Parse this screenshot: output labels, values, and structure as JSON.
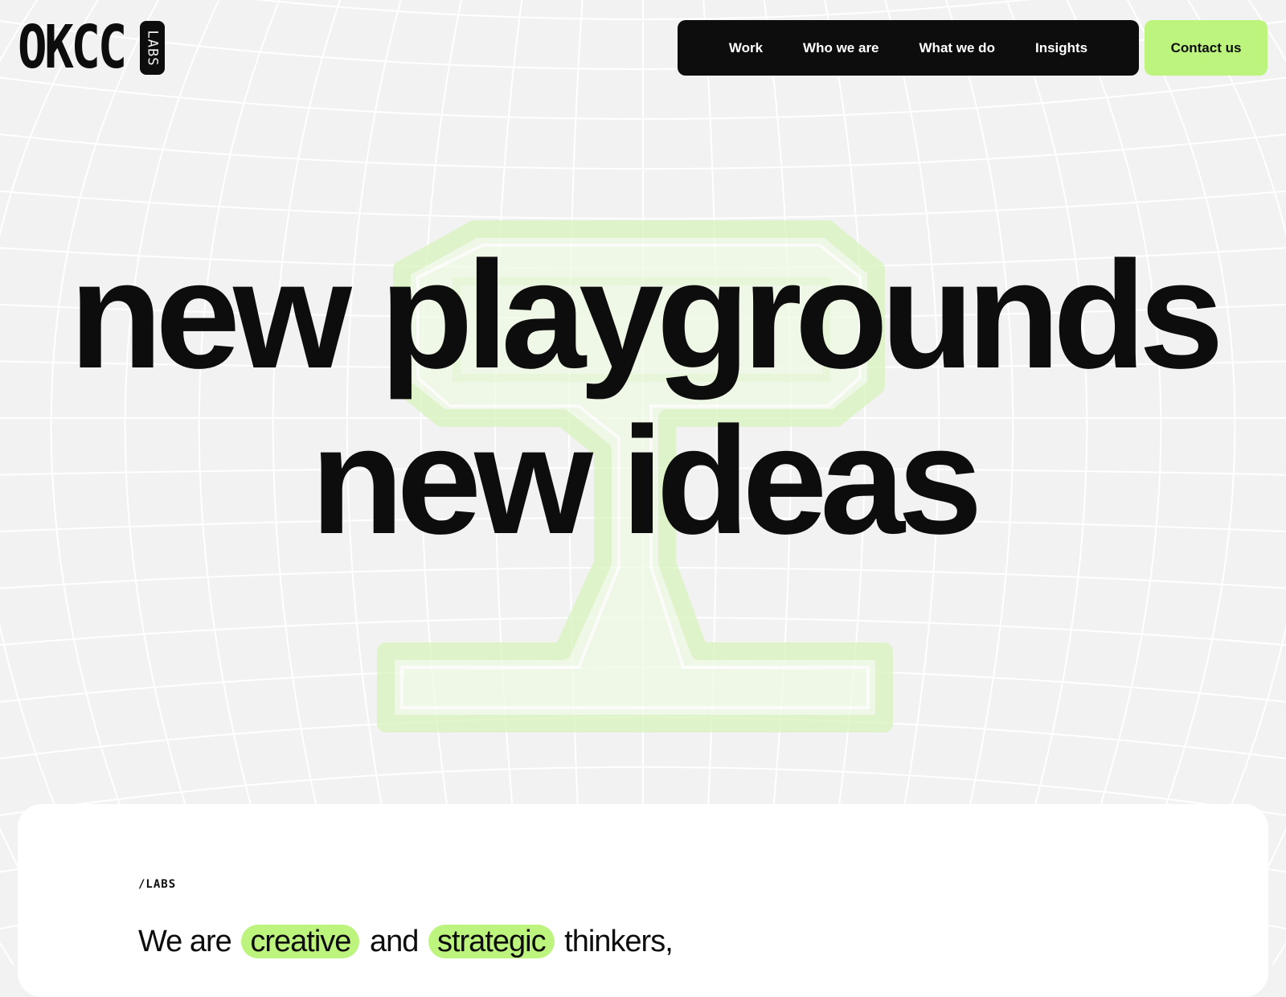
{
  "colors": {
    "background": "#f2f2f2",
    "ink": "#0d0d0d",
    "accent": "#bdf47e",
    "card": "#ffffff",
    "grid": "#ffffff"
  },
  "logo": {
    "main": "OKCC",
    "tag": "LABS",
    "icon": "okcc-labs-logo"
  },
  "nav": {
    "items": [
      {
        "label": "Work"
      },
      {
        "label": "Who we are"
      },
      {
        "label": "What we do"
      },
      {
        "label": "Insights"
      }
    ],
    "contact_label": "Contact us"
  },
  "hero": {
    "line1": "new playgrounds",
    "line2": "new ideas",
    "background_icon": "glass-s-symbol-icon"
  },
  "section": {
    "tag": "/LABS",
    "lead_before": "We are",
    "highlight1": "creative",
    "middle": "and",
    "highlight2": "strategic",
    "lead_after": "thinkers,"
  }
}
